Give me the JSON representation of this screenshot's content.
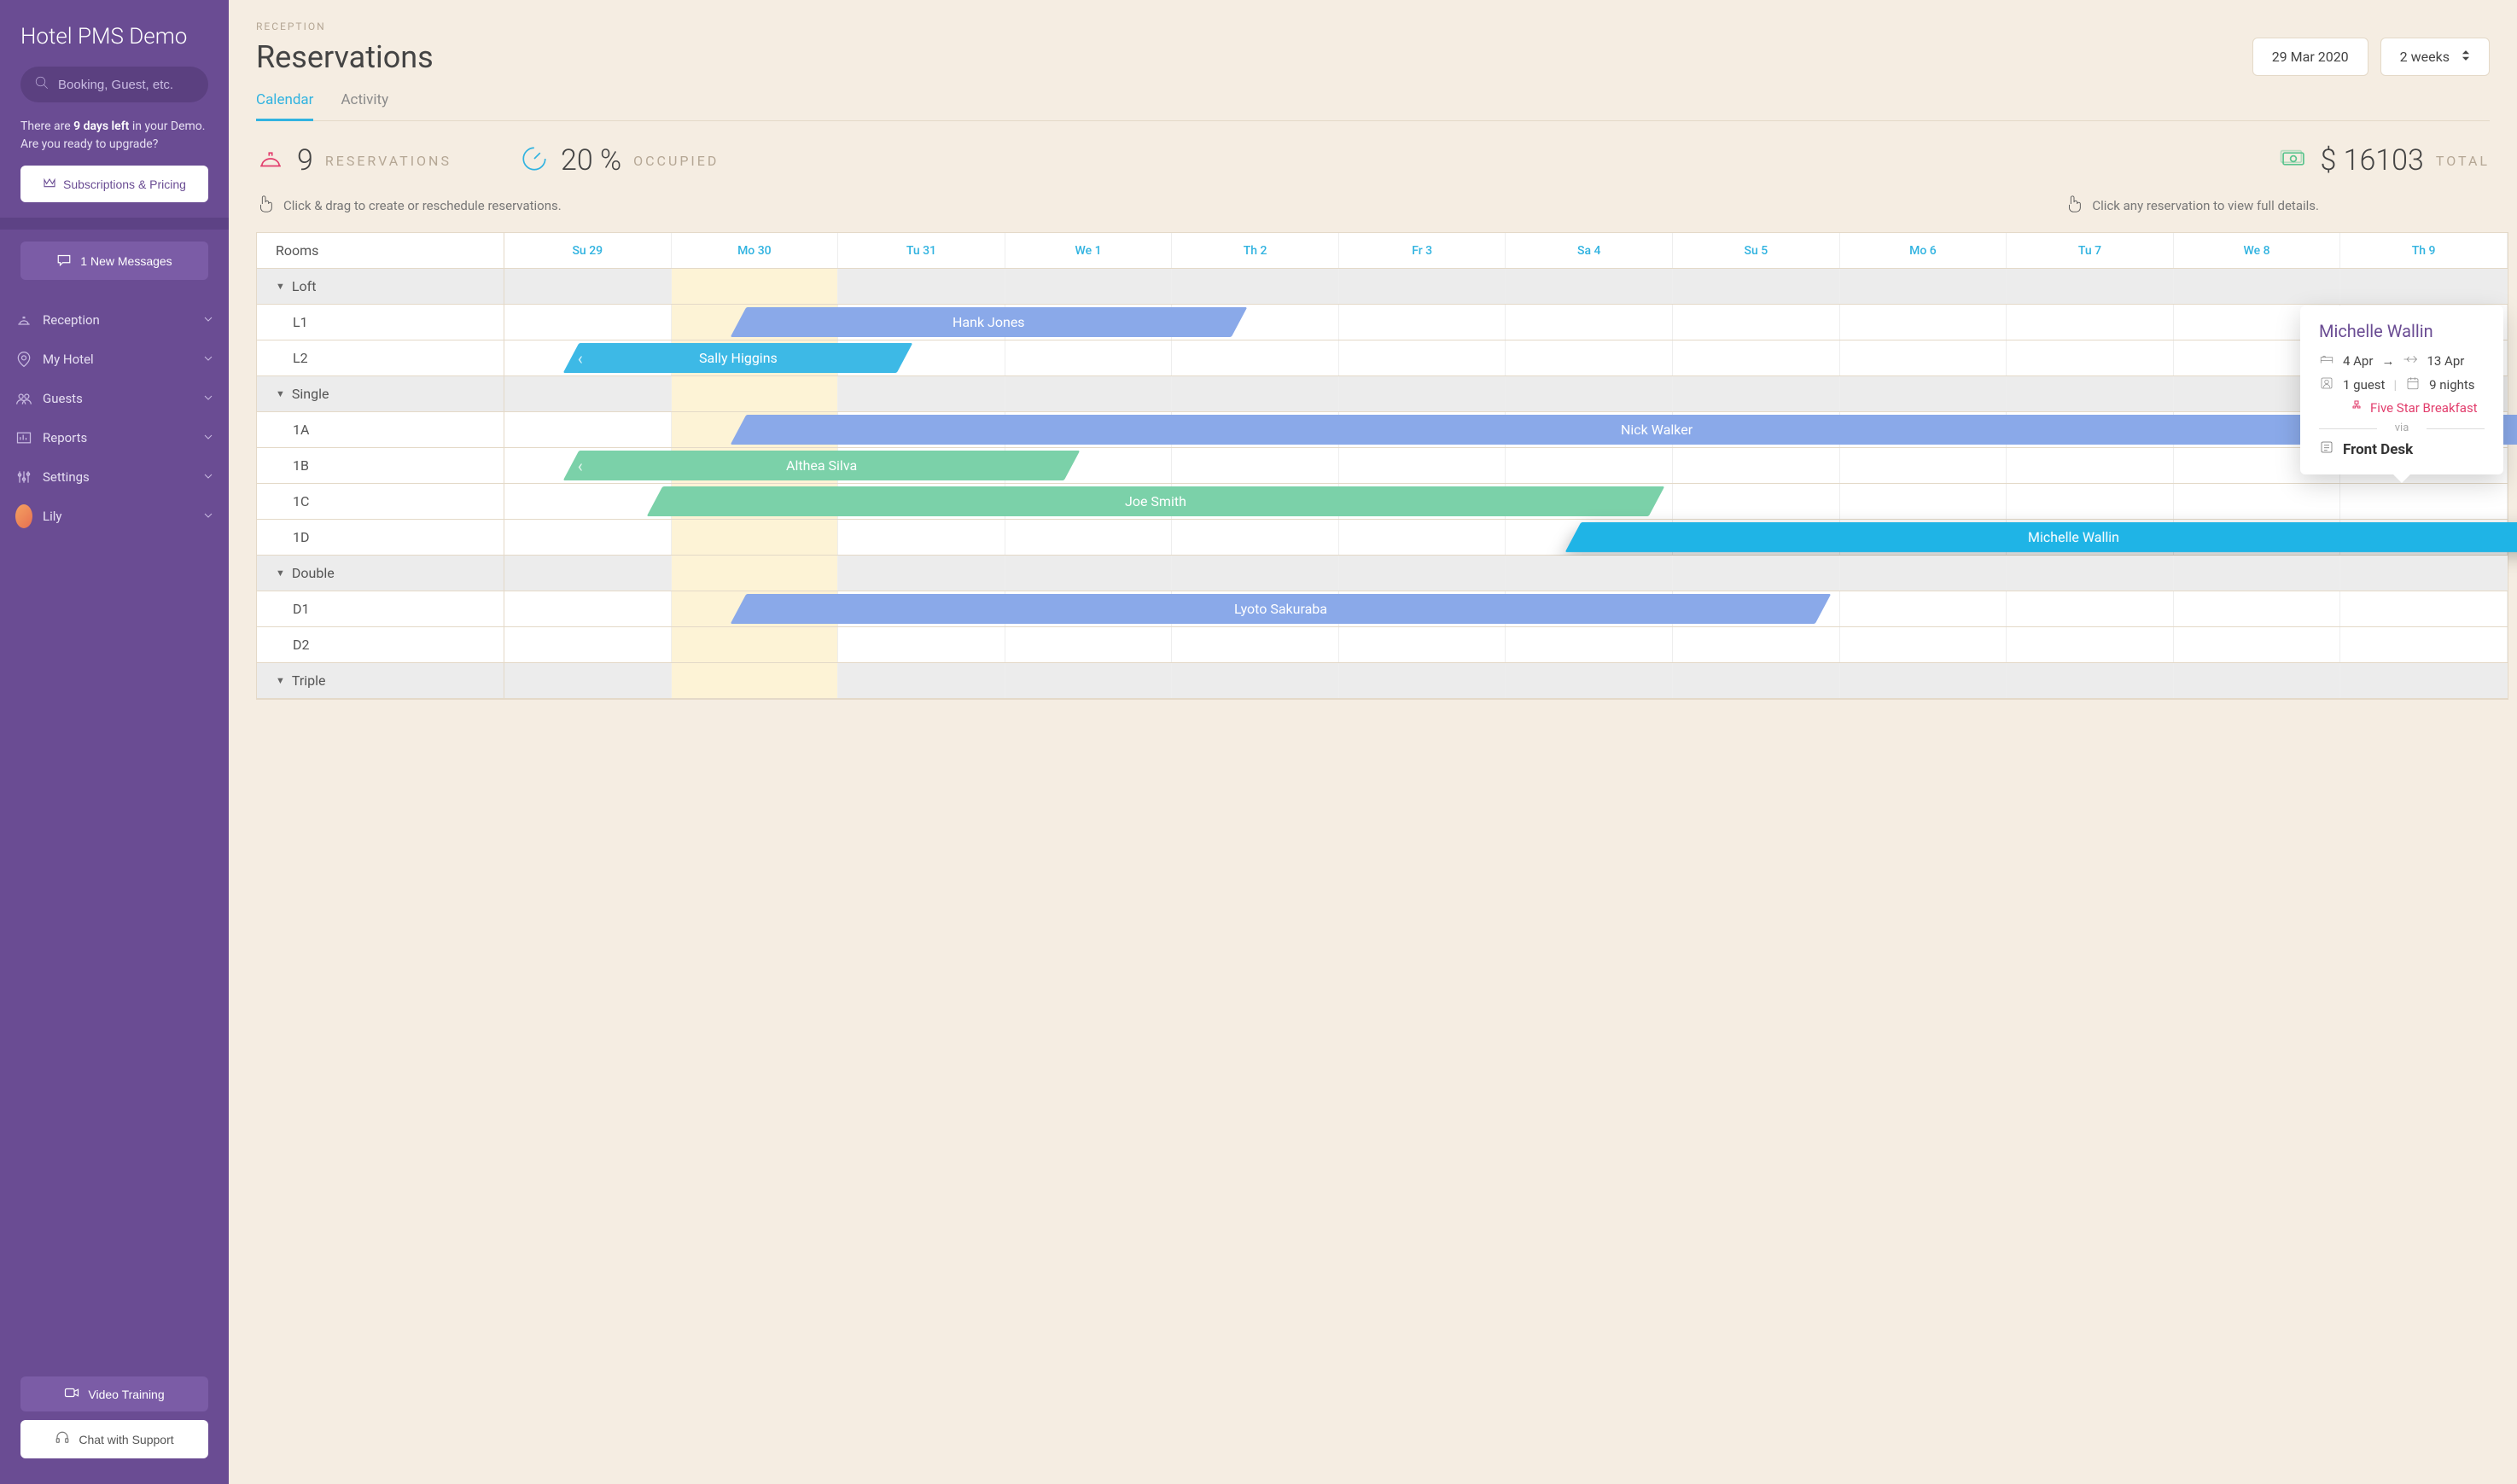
{
  "brand": "Hotel PMS Demo",
  "search": {
    "placeholder": "Booking, Guest, etc."
  },
  "demo_note": {
    "prefix": "There are ",
    "bold": "9 days left",
    "suffix": " in your Demo. Are you ready to upgrade?"
  },
  "subscriptions_btn": "Subscriptions & Pricing",
  "messages_btn": "1 New Messages",
  "nav": [
    {
      "icon": "bell",
      "label": "Reception"
    },
    {
      "icon": "pin",
      "label": "My Hotel"
    },
    {
      "icon": "guests",
      "label": "Guests"
    },
    {
      "icon": "reports",
      "label": "Reports"
    },
    {
      "icon": "settings",
      "label": "Settings"
    },
    {
      "icon": "avatar",
      "label": "Lily"
    }
  ],
  "footer": {
    "video_training": "Video Training",
    "chat_support": "Chat with Support"
  },
  "breadcrumb": "RECEPTION",
  "page_title": "Reservations",
  "date_picker": "29 Mar 2020",
  "range_picker": "2 weeks",
  "tabs": {
    "calendar": "Calendar",
    "activity": "Activity"
  },
  "stats": {
    "reservations": {
      "value": "9",
      "label": "RESERVATIONS"
    },
    "occupied": {
      "value": "20 %",
      "label": "OCCUPIED"
    },
    "total": {
      "value": "$ 16103",
      "label": "TOTAL"
    }
  },
  "hints": {
    "drag": "Click & drag to create or reschedule reservations.",
    "click": "Click any reservation to view full details."
  },
  "calendar": {
    "rooms_header": "Rooms",
    "days": [
      "Su 29",
      "Mo 30",
      "Tu 31",
      "We 1",
      "Th 2",
      "Fr 3",
      "Sa 4",
      "Su 5",
      "Mo 6",
      "Tu 7",
      "We 8",
      "Th 9"
    ],
    "today_index": 1,
    "groups": [
      {
        "name": "Loft",
        "rooms": [
          {
            "name": "L1",
            "bars": [
              {
                "guest": "Hank Jones",
                "start": 1,
                "end": 4,
                "color": "#8aa9e9"
              }
            ]
          },
          {
            "name": "L2",
            "bars": [
              {
                "guest": "Sally Higgins",
                "start": 0,
                "end": 2,
                "color": "#3db9e6",
                "cont_left": true
              }
            ]
          }
        ]
      },
      {
        "name": "Single",
        "rooms": [
          {
            "name": "1A",
            "bars": [
              {
                "guest": "Nick Walker",
                "start": 1,
                "end": 13,
                "color": "#8aa9e9"
              }
            ]
          },
          {
            "name": "1B",
            "bars": [
              {
                "guest": "Althea Silva",
                "start": 0,
                "end": 3,
                "color": "#7bd1a9",
                "cont_left": true
              }
            ]
          },
          {
            "name": "1C",
            "bars": [
              {
                "guest": "Joe Smith",
                "start": 0.5,
                "end": 6.5,
                "color": "#7bd1a9"
              }
            ]
          },
          {
            "name": "1D",
            "bars": [
              {
                "guest": "Michelle Wallin",
                "start": 6,
                "end": 13,
                "color": "#1fb4e6",
                "highlighted": true
              }
            ]
          }
        ]
      },
      {
        "name": "Double",
        "rooms": [
          {
            "name": "D1",
            "bars": [
              {
                "guest": "Lyoto Sakuraba",
                "start": 1,
                "end": 7.5,
                "color": "#8aa9e9"
              }
            ]
          },
          {
            "name": "D2",
            "bars": []
          }
        ]
      },
      {
        "name": "Triple",
        "rooms": []
      }
    ]
  },
  "tooltip": {
    "guest_name": "Michelle Wallin",
    "checkin": "4 Apr",
    "checkout": "13 Apr",
    "guests": "1 guest",
    "nights": "9 nights",
    "rate": "Five Star Breakfast",
    "via_label": "via",
    "source": "Front Desk"
  },
  "colors": {
    "brand_purple": "#6a4c93",
    "accent_cyan": "#31b3e0",
    "pink": "#e23e6d",
    "green": "#5bc48e"
  }
}
